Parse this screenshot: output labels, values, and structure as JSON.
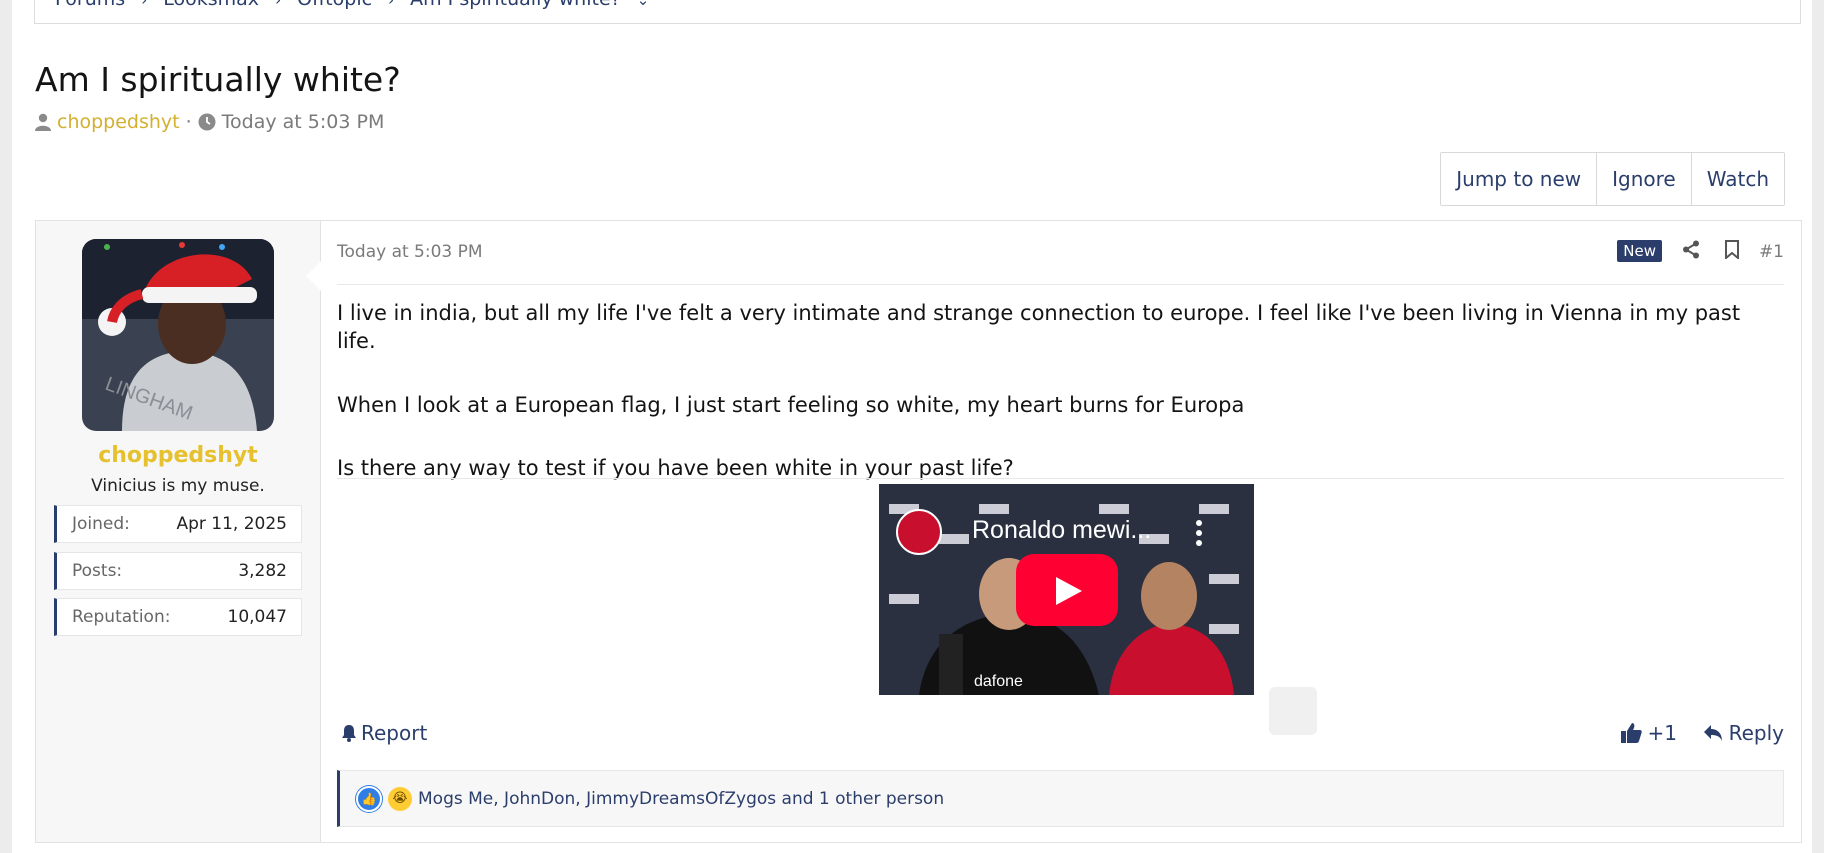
{
  "breadcrumb": {
    "items": [
      "Forums",
      "Looksmax",
      "Offtopic",
      "Am I spiritually white?"
    ]
  },
  "thread": {
    "title": "Am I spiritually white?",
    "author": "choppedshyt",
    "separator": "·",
    "date": "Today at 5:03 PM"
  },
  "actions": {
    "jump_to_new": "Jump to new",
    "ignore": "Ignore",
    "watch": "Watch"
  },
  "user": {
    "name": "choppedshyt",
    "title": "Vinicius is my muse.",
    "stats": [
      {
        "label": "Joined:",
        "value": "Apr 11, 2025"
      },
      {
        "label": "Posts:",
        "value": "3,282"
      },
      {
        "label": "Reputation:",
        "value": "10,047"
      }
    ],
    "avatar_text": "LINGHAM"
  },
  "post": {
    "date": "Today at 5:03 PM",
    "badge": "New",
    "number": "#1",
    "paragraphs": [
      "I live in india, but all my life I've felt a very intimate and strange connection to europe. I feel like I've been living in Vienna in my past life.",
      "When I look at a European flag, I just start feeling so white, my heart burns for Europa",
      "Is there any way to test if you have been white in your past life?"
    ],
    "video": {
      "title": "Ronaldo mewi...",
      "sponsor_text": "dafone"
    },
    "report": "Report",
    "like_count": "+1",
    "reply": "Reply",
    "reactions_text": "Mogs Me, JohnDon, JimmyDreamsOfZygos and 1 other person"
  },
  "colors": {
    "accent": "#2b3e6b",
    "username": "#e6c12d",
    "youtube_red": "#ff0033"
  },
  "icons": [
    "user-icon",
    "clock-icon",
    "share-icon",
    "bookmark-icon",
    "bell-icon",
    "thumbs-up-icon",
    "reply-icon",
    "play-icon",
    "more-icon",
    "pip-icon",
    "like-reaction-icon",
    "cry-reaction-icon"
  ]
}
